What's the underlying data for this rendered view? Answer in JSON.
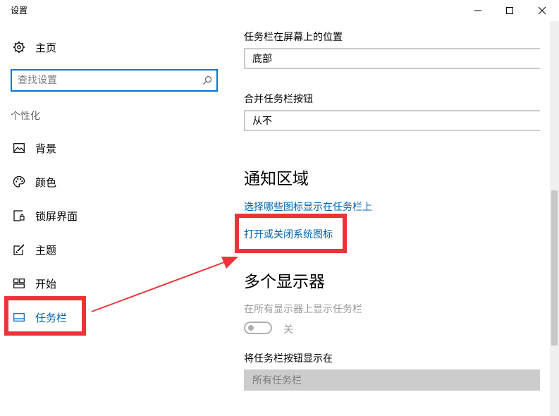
{
  "window": {
    "title": "设置"
  },
  "sidebar": {
    "home_label": "主页",
    "search_placeholder": "查找设置",
    "section_label": "个性化",
    "items": [
      {
        "label": "背景",
        "icon": "picture-icon"
      },
      {
        "label": "颜色",
        "icon": "palette-icon"
      },
      {
        "label": "锁屏界面",
        "icon": "lock-screen-icon"
      },
      {
        "label": "主题",
        "icon": "theme-icon"
      },
      {
        "label": "开始",
        "icon": "start-icon"
      },
      {
        "label": "任务栏",
        "icon": "taskbar-icon",
        "active": true
      }
    ]
  },
  "content": {
    "taskbar_position_label": "任务栏在屏幕上的位置",
    "taskbar_position_value": "底部",
    "combine_buttons_label": "合并任务栏按钮",
    "combine_buttons_value": "从不",
    "notification_heading": "通知区域",
    "notification_link_1": "选择哪些图标显示在任务栏上",
    "notification_link_2": "打开或关闭系统图标",
    "multi_display_heading": "多个显示器",
    "show_on_all_label": "在所有显示器上显示任务栏",
    "show_on_all_state": "关",
    "buttons_on_label": "将任务栏按钮显示在",
    "buttons_on_value": "所有任务栏"
  },
  "colors": {
    "accent": "#0078d7",
    "link": "#0063b1",
    "annotation_red": "#e8353a"
  }
}
